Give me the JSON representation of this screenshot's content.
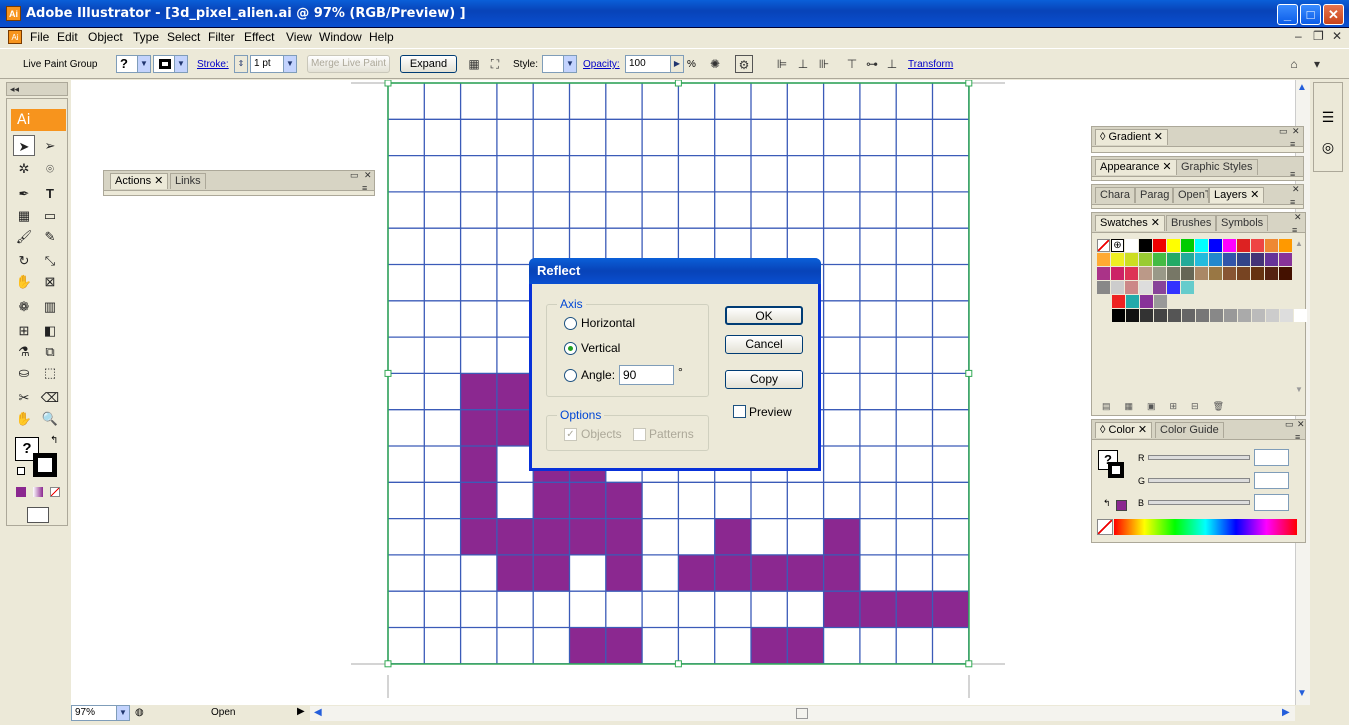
{
  "window": {
    "title": "Adobe Illustrator - [3d_pixel_alien.ai @ 97% (RGB/Preview) ]",
    "app_icon": "Ai"
  },
  "menu": [
    "File",
    "Edit",
    "Object",
    "Type",
    "Select",
    "Filter",
    "Effect",
    "View",
    "Window",
    "Help"
  ],
  "control": {
    "group_label": "Live Paint Group",
    "stroke_label": "Stroke:",
    "stroke_value": "1 pt",
    "merge_label": "Merge Live Paint",
    "expand_label": "Expand",
    "style_label": "Style:",
    "opacity_label": "Opacity:",
    "opacity_value": "100",
    "opacity_unit": "%",
    "transform_label": "Transform"
  },
  "toolbox": {
    "logo": "Ai"
  },
  "panels": {
    "actions": {
      "tabs": [
        "Actions",
        "Links"
      ]
    },
    "gradient": {
      "tab": "Gradient"
    },
    "appearance": {
      "tabs": [
        "Appearance",
        "Graphic Styles"
      ]
    },
    "character": {
      "tabs": [
        "Chara",
        "Parag",
        "OpenT",
        "Layers"
      ]
    },
    "swatches": {
      "tabs": [
        "Swatches",
        "Brushes",
        "Symbols"
      ]
    },
    "color": {
      "tabs": [
        "Color",
        "Color Guide"
      ],
      "r": "R",
      "g": "G",
      "b": "B"
    }
  },
  "dialog": {
    "title": "Reflect",
    "axis_label": "Axis",
    "horizontal": "Horizontal",
    "vertical": "Vertical",
    "angle_label": "Angle:",
    "angle_value": "90",
    "degree": "°",
    "options_label": "Options",
    "objects": "Objects",
    "patterns": "Patterns",
    "ok": "OK",
    "cancel": "Cancel",
    "copy": "Copy",
    "preview": "Preview",
    "selected_axis": "vertical"
  },
  "status": {
    "zoom": "97%",
    "state": "Open"
  },
  "colors": {
    "accent": "#8b2890",
    "grid": "#3b5bb8",
    "bbox": "#33aa55"
  }
}
